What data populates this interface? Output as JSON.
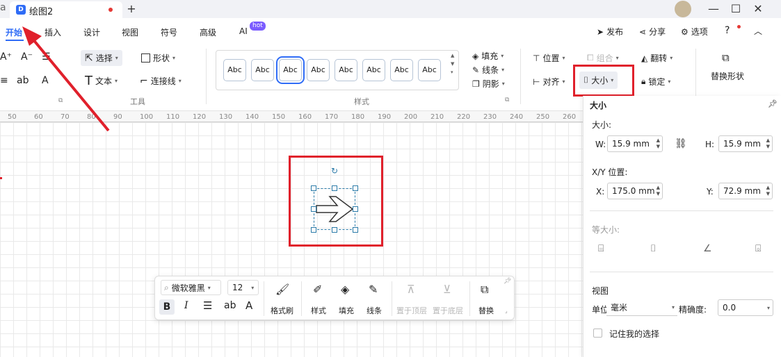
{
  "tab": {
    "title": "绘图2",
    "logo": "D"
  },
  "window": {
    "new_tab": "+",
    "minimize": "—",
    "maximize": "☐",
    "close": "✕"
  },
  "menu": {
    "items": [
      "开始",
      "插入",
      "设计",
      "视图",
      "符号",
      "高级",
      "AI"
    ],
    "hot": "hot",
    "right": {
      "publish": "发布",
      "share": "分享",
      "options": "选项"
    }
  },
  "ribbon": {
    "select": "选择",
    "shape": "形状",
    "text": "文本",
    "connector": "连接线",
    "tools_group": "工具",
    "style_group": "样式",
    "abc": [
      "Abc",
      "Abc",
      "Abc",
      "Abc",
      "Abc",
      "Abc",
      "Abc",
      "Abc"
    ],
    "fill": "填充",
    "line": "线条",
    "shadow": "阴影",
    "position": "位置",
    "group": "组合",
    "flip": "翻转",
    "align": "对齐",
    "size": "大小",
    "lock": "锁定",
    "replace_shape": "替换形状"
  },
  "ruler": [
    "50",
    "60",
    "70",
    "80",
    "90",
    "100",
    "110",
    "120",
    "130",
    "140",
    "150",
    "160",
    "170",
    "180",
    "190",
    "200",
    "210",
    "220",
    "230",
    "240",
    "250",
    "260"
  ],
  "panel": {
    "title": "大小",
    "size_label": "大小:",
    "w_label": "W:",
    "w_value": "15.9 mm",
    "h_label": "H:",
    "h_value": "15.9 mm",
    "pos_label": "X/Y 位置:",
    "x_label": "X:",
    "x_value": "175.0 mm",
    "y_label": "Y:",
    "y_value": "72.9 mm",
    "equal_size": "等大小:",
    "view": "视图",
    "unit_label": "单位:",
    "unit_value": "毫米",
    "precision_label": "精确度:",
    "precision_value": "0.0",
    "remember": "记住我的选择"
  },
  "floatbar": {
    "font": "微软雅黑",
    "font_size": "12",
    "b": "B",
    "i": "I",
    "ab": "ab",
    "a": "A",
    "format_painter": "格式刷",
    "style": "样式",
    "fill": "填充",
    "line": "线条",
    "to_top": "置于顶层",
    "to_bottom": "置于底层",
    "replace": "替换"
  },
  "colors": {
    "accent": "#2f6cf6",
    "highlight": "#e0202b",
    "handle": "#2a7aa8"
  }
}
